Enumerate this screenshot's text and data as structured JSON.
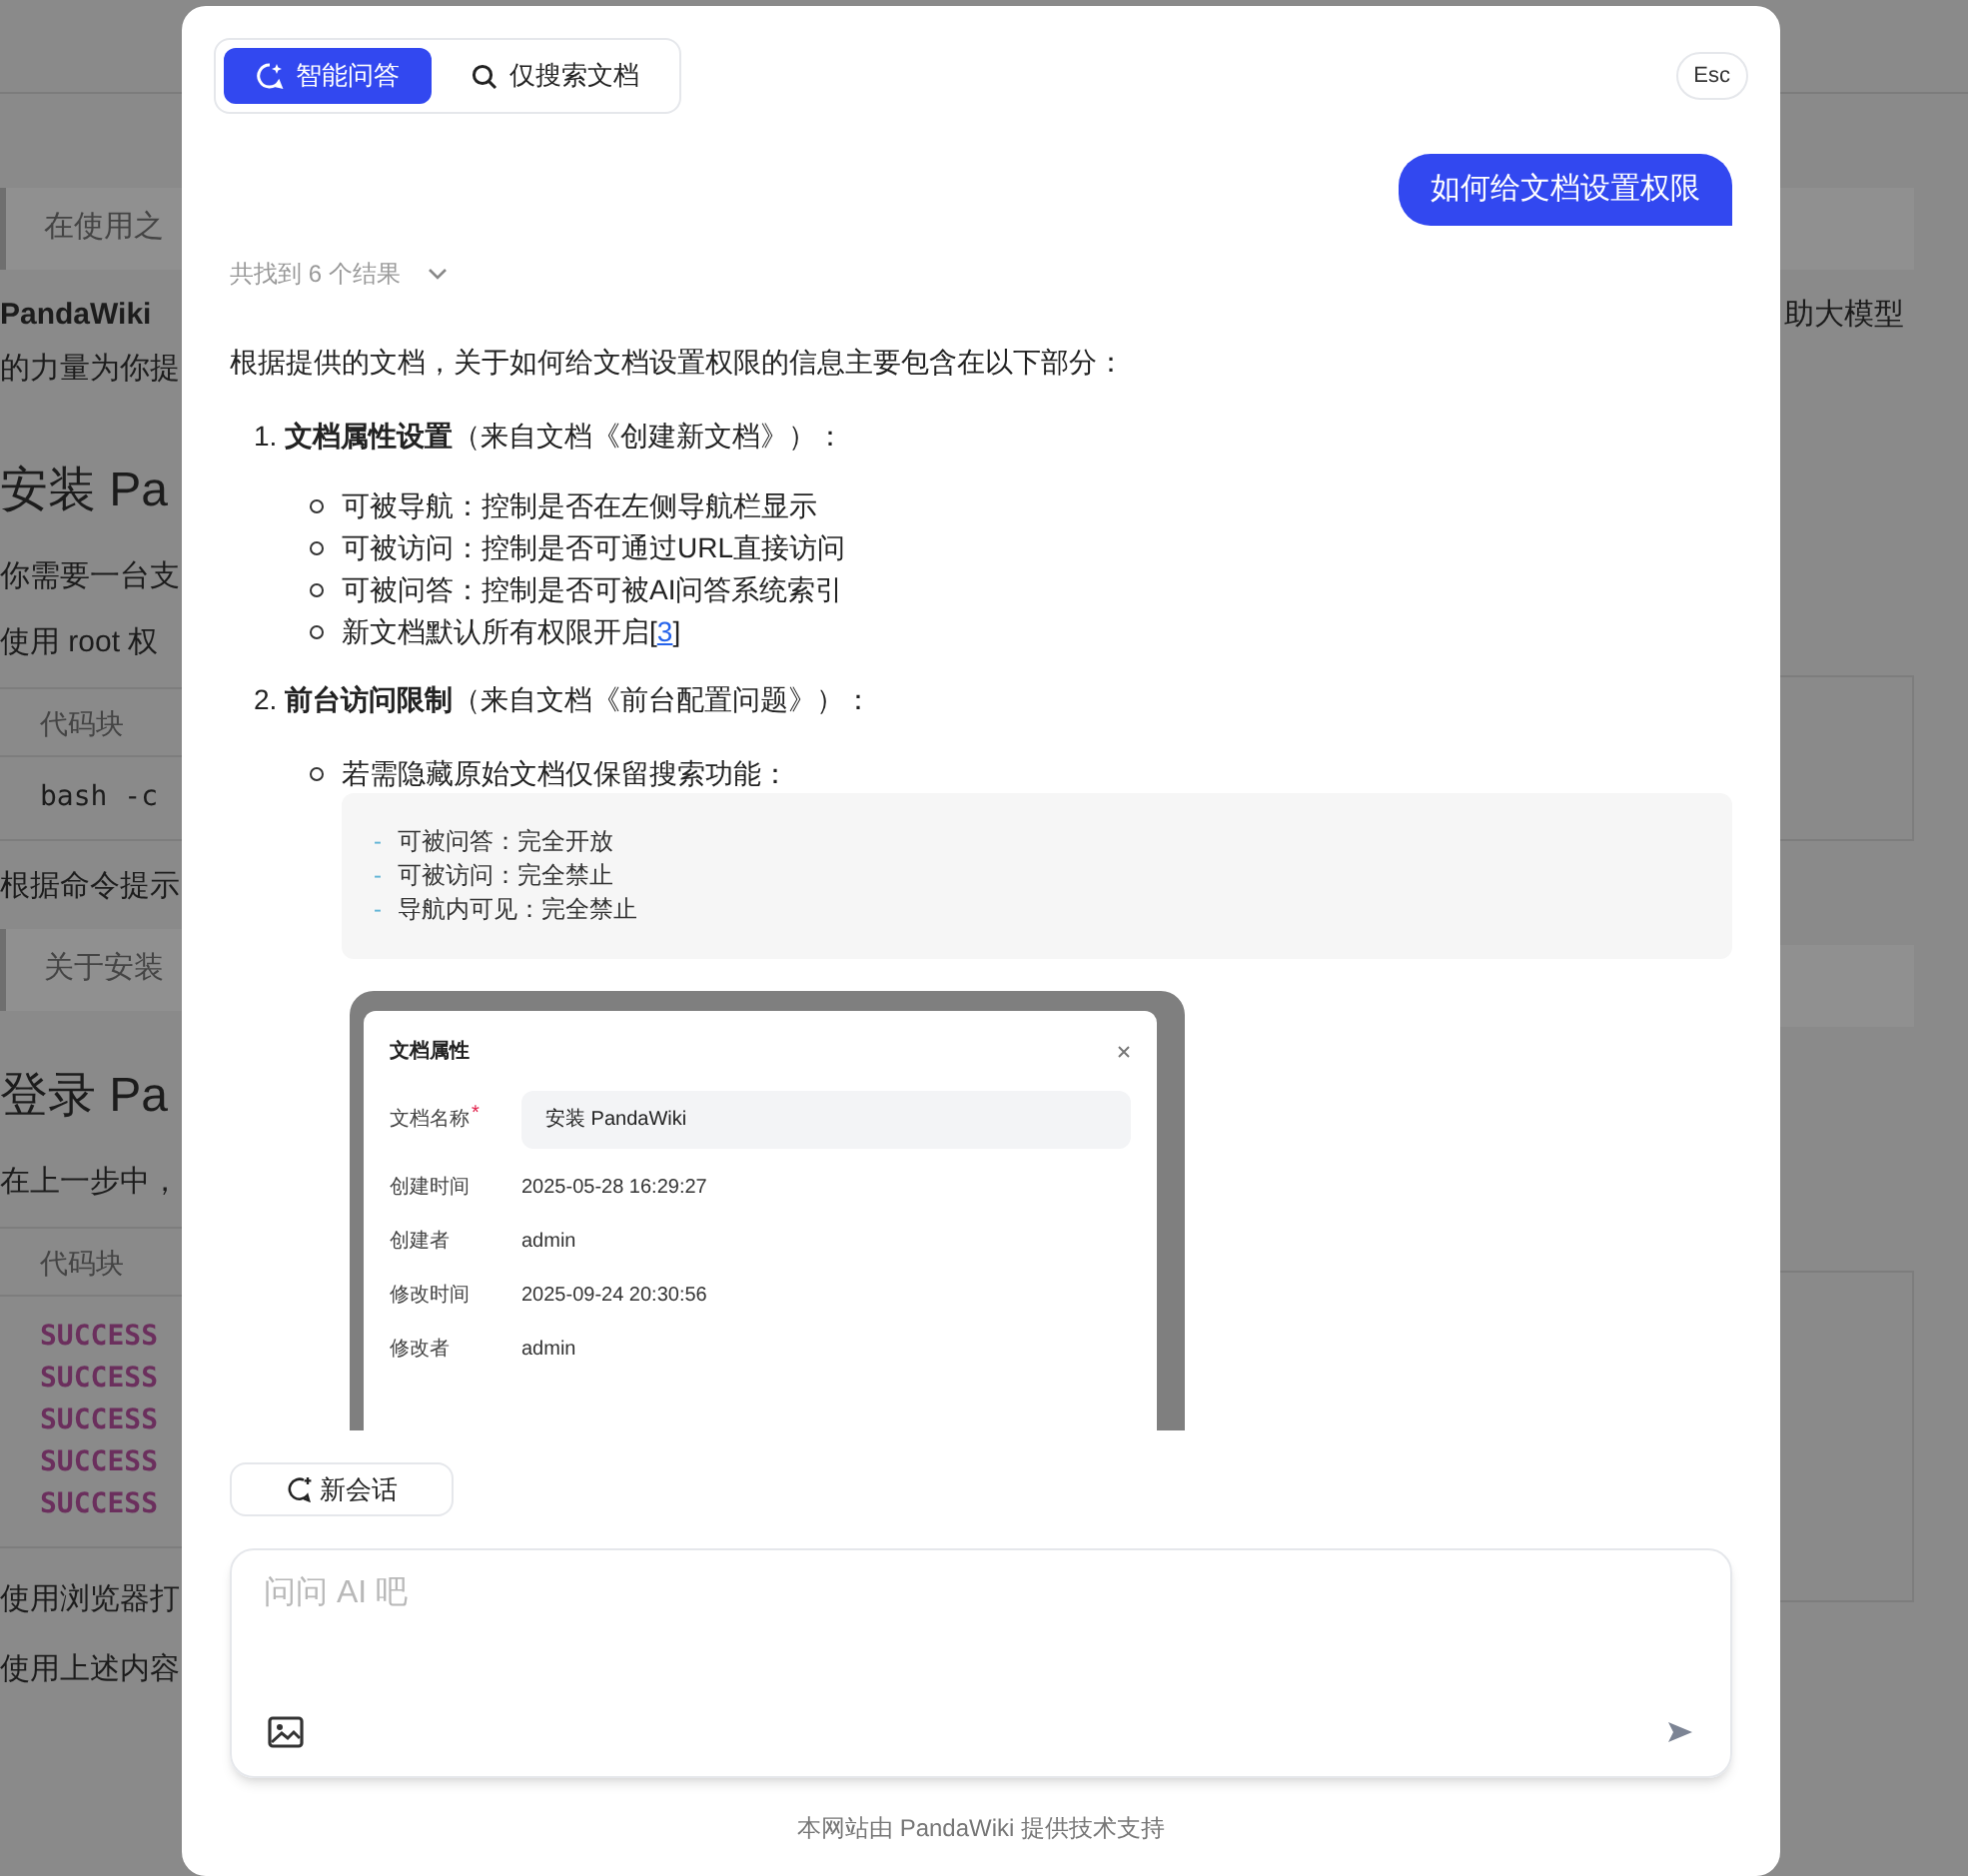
{
  "background": {
    "left": [
      {
        "kind": "quote",
        "text": "在使用之"
      },
      {
        "kind": "strong",
        "text": "PandaWiki"
      },
      {
        "kind": "text",
        "text": "的力量为你提"
      },
      {
        "kind": "heading",
        "text": "安装 Pa"
      },
      {
        "kind": "text",
        "text": "你需要一台支"
      },
      {
        "kind": "text",
        "text": "使用 root 权"
      },
      {
        "kind": "code",
        "header": "代码块",
        "lines": [
          {
            "kind": "plain",
            "text": "bash -c"
          }
        ]
      },
      {
        "kind": "text",
        "text": "根据命令提示"
      },
      {
        "kind": "quote",
        "text": "关于安装"
      },
      {
        "kind": "heading",
        "text": "登录 Pa"
      },
      {
        "kind": "text",
        "text": "在上一步中，"
      },
      {
        "kind": "code",
        "header": "代码块",
        "lines": [
          {
            "kind": "keyword",
            "text": "SUCCESS"
          },
          {
            "kind": "keyword",
            "text": "SUCCESS"
          },
          {
            "kind": "keyword",
            "text": "SUCCESS"
          },
          {
            "kind": "keyword",
            "text": "SUCCESS"
          },
          {
            "kind": "keyword",
            "text": "SUCCESS"
          }
        ]
      },
      {
        "kind": "text",
        "text": "使用浏览器打"
      },
      {
        "kind": "text",
        "text": "使用上述内容"
      }
    ],
    "right_text": "助大模型"
  },
  "dialog": {
    "tabs": [
      {
        "label": "智能问答",
        "selected": true
      },
      {
        "label": "仅搜索文档",
        "selected": false
      }
    ],
    "esc_key": "Esc",
    "question": "如何给文档设置权限",
    "results_summary": "共找到 6 个结果",
    "results_expanded": false,
    "answer": {
      "intro": "根据提供的文档，关于如何给文档设置权限的信息主要包含在以下部分：",
      "sections": [
        {
          "number": "1.",
          "title": "文档属性设置",
          "source": "（来自文档《创建新文档》）：",
          "bullets": [
            {
              "text": "可被导航：控制是否在左侧导航栏显示"
            },
            {
              "text": "可被访问：控制是否可通过URL直接访问"
            },
            {
              "text": "可被问答：控制是否可被AI问答系统索引"
            },
            {
              "text": "新文档默认所有权限开启[",
              "link": "3",
              "after": "]"
            }
          ]
        },
        {
          "number": "2.",
          "title": "前台访问限制",
          "source": "（来自文档《前台配置问题》）：",
          "bullets": [
            {
              "text": "若需隐藏原始文档仅保留搜索功能：",
              "code": [
                {
                  "marker": "-",
                  "text": "可被问答：完全开放"
                },
                {
                  "marker": "-",
                  "text": "可被访问：完全禁止"
                },
                {
                  "marker": "-",
                  "text": "导航内可见：完全禁止"
                }
              ]
            }
          ]
        }
      ],
      "screenshot": {
        "title": "文档属性",
        "fields": [
          {
            "label": "文档名称",
            "required_mark": "*",
            "value": "安装 PandaWiki",
            "kind": "input"
          },
          {
            "label": "创建时间",
            "value": "2025-05-28 16:29:27",
            "kind": "text"
          },
          {
            "label": "创建者",
            "value": "admin",
            "kind": "text"
          },
          {
            "label": "修改时间",
            "value": "2025-09-24 20:30:56",
            "kind": "text"
          },
          {
            "label": "修改者",
            "value": "admin",
            "kind": "text"
          }
        ]
      }
    },
    "new_chat_button": "新会话",
    "input": {
      "placeholder": "问问 AI 吧"
    },
    "footer": "本网站由 PandaWiki 提供技术支持"
  }
}
